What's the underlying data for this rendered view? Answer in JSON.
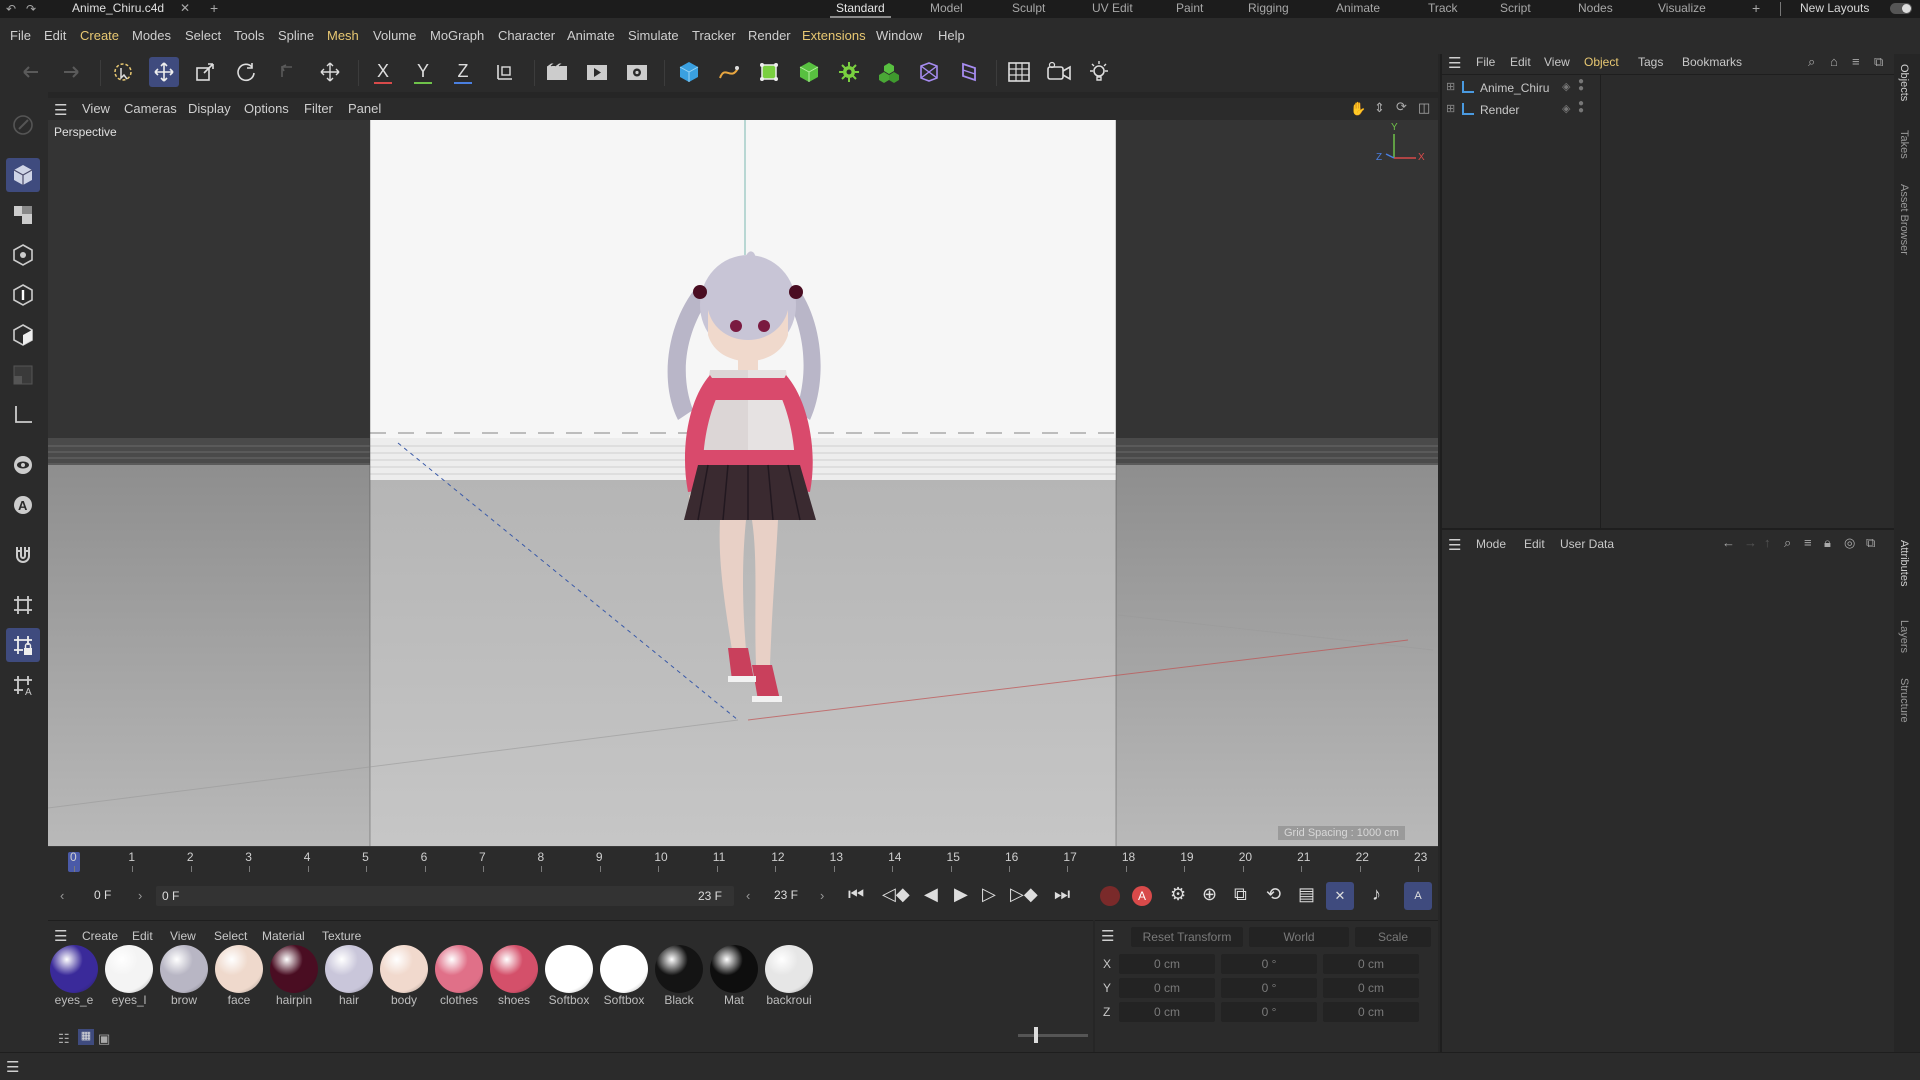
{
  "titlebar": {
    "file_name": "Anime_Chiru.c4d",
    "layouts": [
      "Standard",
      "Model",
      "Sculpt",
      "UV Edit",
      "Paint",
      "Rigging",
      "Animate",
      "Track",
      "Script",
      "Nodes",
      "Visualize"
    ],
    "active_layout": "Standard",
    "new_layouts": "New Layouts"
  },
  "menubar": [
    "File",
    "Edit",
    "Create",
    "Modes",
    "Select",
    "Tools",
    "Spline",
    "Mesh",
    "Volume",
    "MoGraph",
    "Character",
    "Animate",
    "Simulate",
    "Tracker",
    "Render",
    "Extensions",
    "Window",
    "Help"
  ],
  "toolbar": {
    "axis_x": "X",
    "axis_y": "Y",
    "axis_z": "Z"
  },
  "viewport": {
    "menu": [
      "View",
      "Cameras",
      "Display",
      "Options",
      "Filter",
      "Panel"
    ],
    "label": "Perspective",
    "grid_spacing": "Grid Spacing : 1000 cm",
    "axis_y": "Y",
    "axis_x": "X",
    "axis_z": "Z"
  },
  "timeline": {
    "ticks": [
      "0",
      "1",
      "2",
      "3",
      "4",
      "5",
      "6",
      "7",
      "8",
      "9",
      "10",
      "11",
      "12",
      "13",
      "14",
      "15",
      "16",
      "17",
      "18",
      "19",
      "20",
      "21",
      "22",
      "23"
    ],
    "current_frame": "0 F",
    "range_start": "0 F",
    "range_end": "23 F",
    "end_frame": "23 F",
    "playhead_fraction": 0.0
  },
  "materials": {
    "menu": [
      "Create",
      "Edit",
      "View",
      "Select",
      "Material",
      "Texture"
    ],
    "items": [
      {
        "name": "eyes_e",
        "color": "#3a2a9a"
      },
      {
        "name": "eyes_l",
        "color": "#f4f4f4"
      },
      {
        "name": "brow",
        "color": "#b8b6c4"
      },
      {
        "name": "face",
        "color": "#efd9cc"
      },
      {
        "name": "hairpin",
        "color": "#4a0d22"
      },
      {
        "name": "hair",
        "color": "#c9c6da"
      },
      {
        "name": "body",
        "color": "#f1d9cd"
      },
      {
        "name": "clothes",
        "color": "#e07088"
      },
      {
        "name": "shoes",
        "color": "#d4506a"
      },
      {
        "name": "Softbox",
        "color": "#ffffff"
      },
      {
        "name": "Softbox",
        "color": "#ffffff"
      },
      {
        "name": "Black",
        "color": "#141414"
      },
      {
        "name": "Mat",
        "color": "#0e0e0e"
      },
      {
        "name": "backroui",
        "color": "#e6e6e6"
      }
    ]
  },
  "coordinates": {
    "reset": "Reset Transform",
    "space": "World",
    "mode": "Scale",
    "rows": [
      {
        "axis": "X",
        "pos": "0 cm",
        "rot": "0 °",
        "scale": "0 cm"
      },
      {
        "axis": "Y",
        "pos": "0 cm",
        "rot": "0 °",
        "scale": "0 cm"
      },
      {
        "axis": "Z",
        "pos": "0 cm",
        "rot": "0 °",
        "scale": "0 cm"
      }
    ]
  },
  "objects": {
    "menu": [
      "File",
      "Edit",
      "View",
      "Object",
      "Tags",
      "Bookmarks"
    ],
    "active_menu": "Object",
    "items": [
      "Anime_Chiru",
      "Render"
    ]
  },
  "attributes": {
    "menu": [
      "Mode",
      "Edit",
      "User Data"
    ]
  },
  "sidetabs": [
    "Objects",
    "Takes",
    "Asset Browser",
    "Attributes",
    "Layers",
    "Structure"
  ],
  "colors": {
    "accent": "#3f4b7e",
    "menu_highlight": "#e8c872",
    "red_axis": "#d84a4a",
    "green_axis": "#6fc24a",
    "blue_axis": "#4a7fe0"
  }
}
